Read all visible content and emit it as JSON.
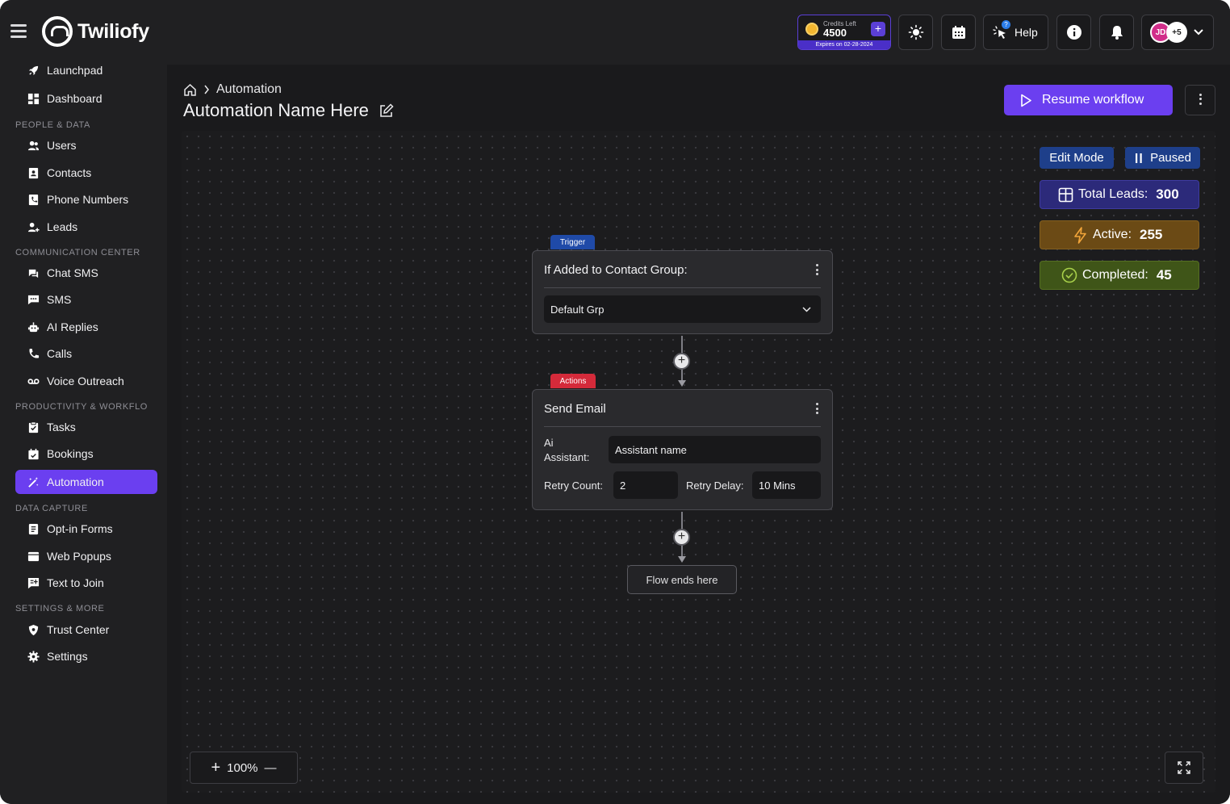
{
  "app": {
    "name": "Twiliofy"
  },
  "topbar": {
    "credits": {
      "label": "Credits Left",
      "value": "4500",
      "expires": "Expires on 02-28-2024",
      "add": "+"
    },
    "help_label": "Help",
    "avatar_initials": "JD",
    "avatar_more": "+5",
    "help_badge": "?"
  },
  "sidebar": {
    "top_items": [
      {
        "label": "Launchpad",
        "icon": "rocket-icon"
      },
      {
        "label": "Dashboard",
        "icon": "grid-icon"
      }
    ],
    "sections": [
      {
        "title": "PEOPLE & DATA",
        "items": [
          {
            "label": "Users",
            "icon": "users-icon"
          },
          {
            "label": "Contacts",
            "icon": "contact-card-icon"
          },
          {
            "label": "Phone Numbers",
            "icon": "phone-book-icon"
          },
          {
            "label": "Leads",
            "icon": "user-plus-icon"
          }
        ]
      },
      {
        "title": "COMMUNICATION CENTER",
        "items": [
          {
            "label": "Chat SMS",
            "icon": "chat-icon"
          },
          {
            "label": "SMS",
            "icon": "message-icon"
          },
          {
            "label": "AI Replies",
            "icon": "robot-icon"
          },
          {
            "label": "Calls",
            "icon": "phone-icon"
          },
          {
            "label": "Voice Outreach",
            "icon": "voicemail-icon"
          }
        ]
      },
      {
        "title": "PRODUCTIVITY & WORKFLO",
        "items": [
          {
            "label": "Tasks",
            "icon": "clipboard-check-icon"
          },
          {
            "label": "Bookings",
            "icon": "calendar-check-icon"
          },
          {
            "label": "Automation",
            "icon": "magic-wand-icon",
            "active": true
          }
        ]
      },
      {
        "title": "DATA CAPTURE",
        "items": [
          {
            "label": "Opt-in Forms",
            "icon": "form-icon"
          },
          {
            "label": "Web Popups",
            "icon": "window-icon"
          },
          {
            "label": "Text to Join",
            "icon": "text-join-icon"
          }
        ]
      },
      {
        "title": "SETTINGS & MORE",
        "items": [
          {
            "label": "Trust Center",
            "icon": "shield-icon"
          },
          {
            "label": "Settings",
            "icon": "gear-icon"
          }
        ]
      }
    ]
  },
  "header": {
    "breadcrumb": "Automation",
    "title": "Automation Name Here",
    "resume_label": "Resume workflow"
  },
  "status": {
    "edit_mode": "Edit Mode",
    "paused": "Paused",
    "total_leads_label": "Total Leads:",
    "total_leads": "300",
    "active_label": "Active:",
    "active": "255",
    "completed_label": "Completed:",
    "completed": "45"
  },
  "colors": {
    "accent": "#6b3ff0",
    "trigger_tag": "#1f4aa8",
    "actions_tag": "#d42a3a",
    "total_bg": "#2c2a7a",
    "active_bg": "#6b4a15",
    "completed_bg": "#3f5518"
  },
  "trigger": {
    "tag": "Trigger",
    "title": "If Added to Contact Group:",
    "group_value": "Default Grp"
  },
  "action": {
    "tag": "Actions",
    "title": "Send Email",
    "assistant_label_1": "Ai",
    "assistant_label_2": "Assistant:",
    "assistant_value": "Assistant name",
    "retry_count_label": "Retry Count:",
    "retry_count": "2",
    "retry_delay_label": "Retry Delay:",
    "retry_delay": "10 Mins"
  },
  "flow_end": "Flow ends here",
  "zoom": {
    "plus": "+",
    "level": "100%",
    "minus": "—"
  }
}
